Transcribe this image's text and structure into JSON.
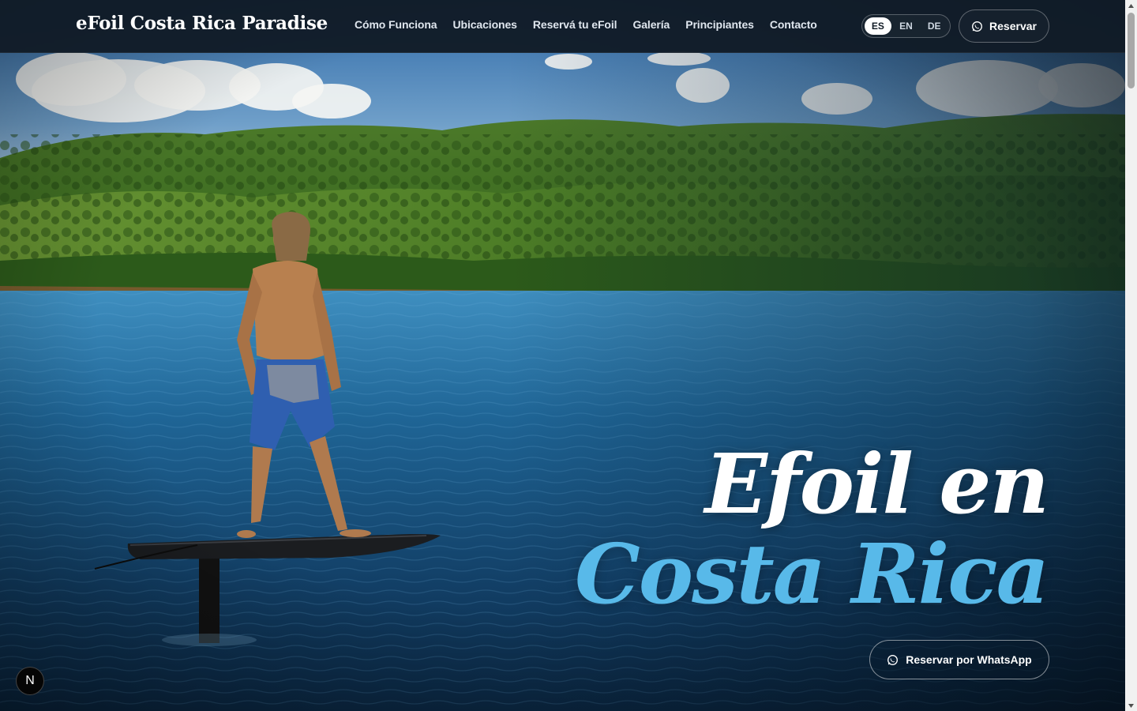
{
  "brand": {
    "name": "eFoil Costa Rica Paradise"
  },
  "nav": {
    "items": [
      {
        "label": "Cómo Funciona"
      },
      {
        "label": "Ubicaciones"
      },
      {
        "label": "Reservá tu eFoil"
      },
      {
        "label": "Galería"
      },
      {
        "label": "Principiantes"
      },
      {
        "label": "Contacto"
      }
    ]
  },
  "language": {
    "options": [
      "ES",
      "EN",
      "DE"
    ],
    "selected": "ES"
  },
  "header_cta": {
    "label": "Reservar",
    "icon": "whatsapp-icon"
  },
  "hero": {
    "headline_line1": "Efoil en",
    "headline_line2": "Costa Rica",
    "cta_label": "Reservar por WhatsApp",
    "cta_icon": "whatsapp-icon",
    "image": "person-standing-on-efoil-lake-hills-photo"
  },
  "dev_badge": {
    "label": "N"
  },
  "colors": {
    "header_bg": "#111b26",
    "accent": "#58b9e9",
    "headline_white": "#ffffff"
  }
}
